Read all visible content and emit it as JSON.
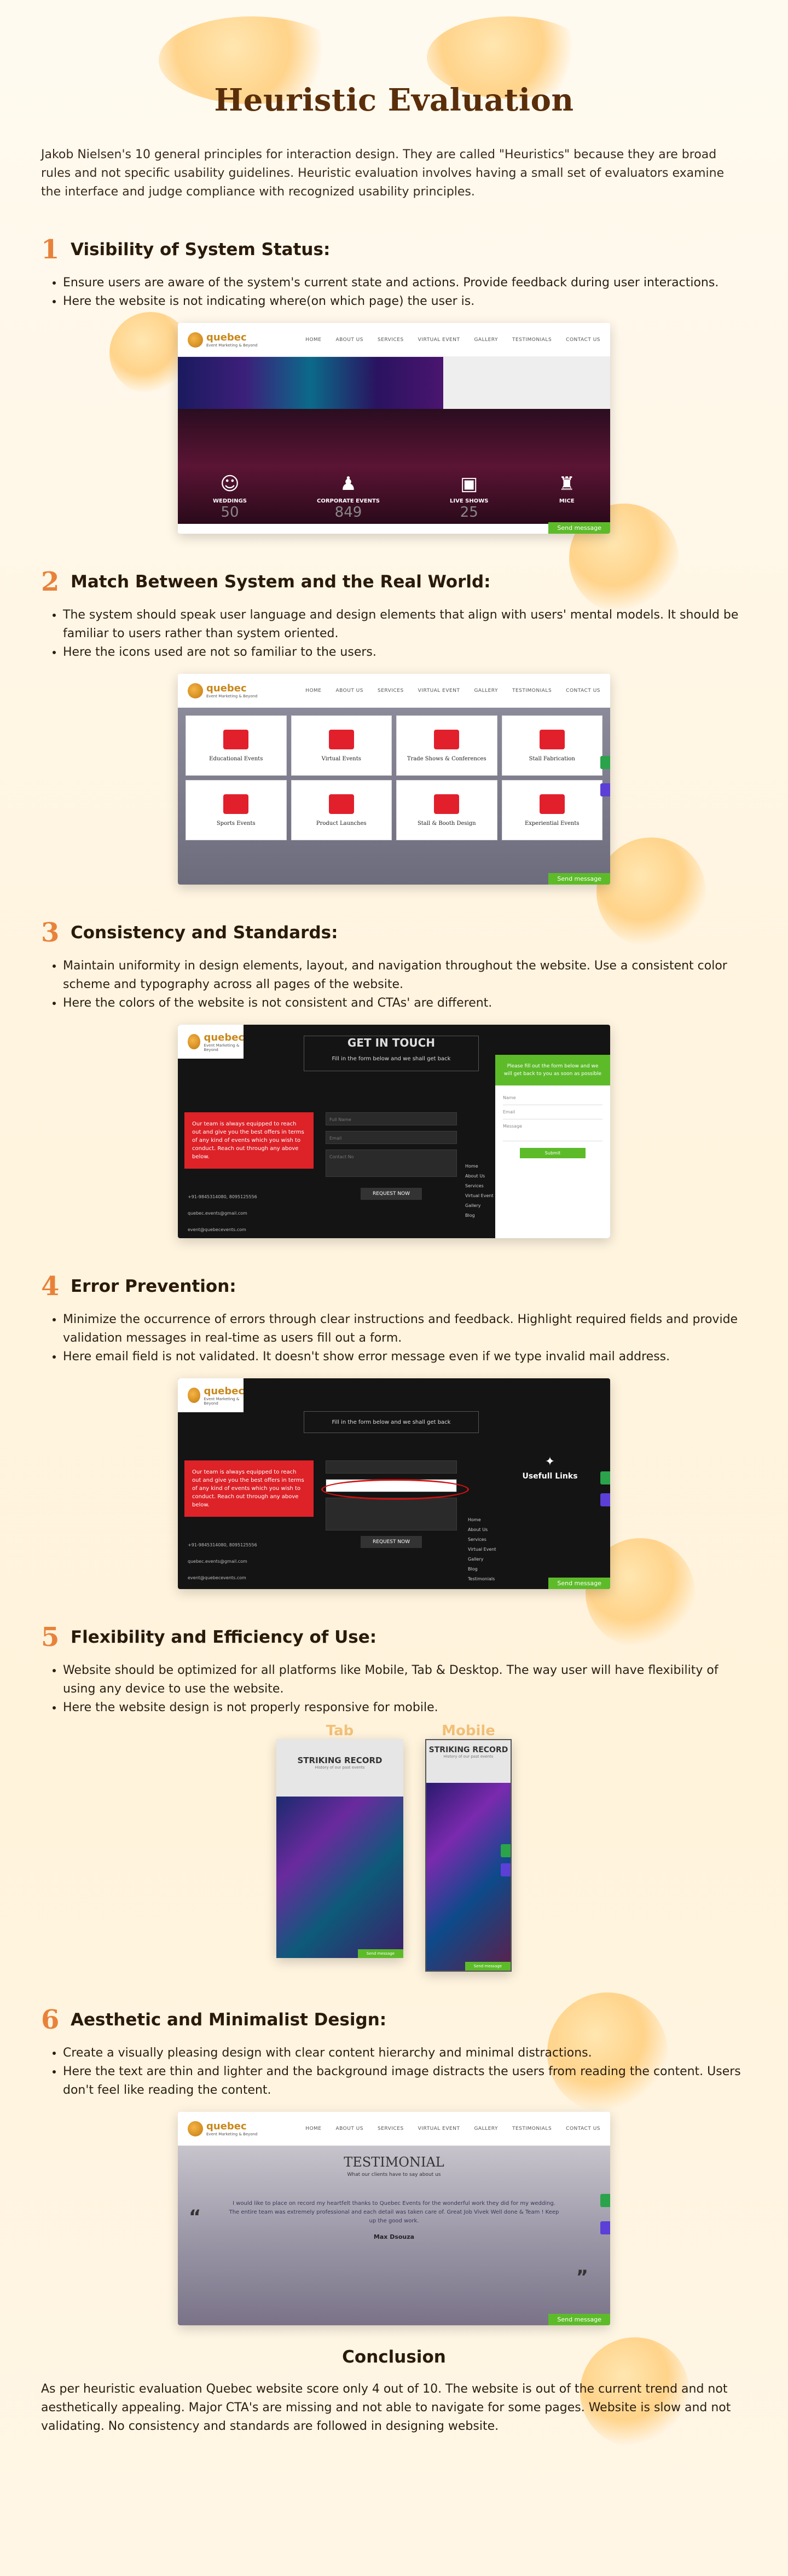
{
  "title": "Heuristic Evaluation",
  "intro": "Jakob Nielsen's 10 general principles for interaction design. They are called \"Heuristics\" because they are broad rules and not specific usability guidelines. Heuristic evaluation involves having a small set of evaluators examine the interface and judge compliance with recognized usability principles.",
  "sections": [
    {
      "number": "1",
      "heading": "Visibility of System Status:",
      "bullets": [
        "Ensure users are aware of the system's current state and actions. Provide feedback during user interactions.",
        "Here the website is not indicating where(on which page) the user is."
      ]
    },
    {
      "number": "2",
      "heading": "Match Between System and the Real World:",
      "bullets": [
        "The system should speak user language and design elements that align with users' mental models. It should be familiar to users rather than system oriented.",
        "Here the icons used are not so familiar to the users."
      ]
    },
    {
      "number": "3",
      "heading": "Consistency and Standards:",
      "bullets": [
        "Maintain uniformity in design elements, layout, and navigation throughout the website. Use a consistent color scheme and typography across all pages of the website.",
        "Here the colors of the website is not consistent and CTAs' are different."
      ]
    },
    {
      "number": "4",
      "heading": "Error Prevention:",
      "bullets": [
        "Minimize the occurrence of errors through clear instructions and feedback. Highlight required fields and provide validation messages in real-time as users fill out a form.",
        "Here email field is not validated. It doesn't show error message even if we type invalid mail address."
      ]
    },
    {
      "number": "5",
      "heading": "Flexibility and Efficiency of Use:",
      "bullets": [
        "Website should be optimized for all platforms like Mobile, Tab & Desktop.  The way user will have flexibility of using any device to use the website.",
        "Here the website design is not properly responsive for mobile."
      ]
    },
    {
      "number": "6",
      "heading": "Aesthetic and Minimalist Design:",
      "bullets": [
        "Create a visually pleasing design with clear content hierarchy and minimal distractions.",
        "Here the text are thin and lighter and the background image distracts the users from reading the content. Users don't feel like reading the content."
      ]
    }
  ],
  "site": {
    "logo": "quebec",
    "logo_tagline": "Event Marketing & Beyond",
    "nav": [
      "HOME",
      "ABOUT US",
      "SERVICES",
      "VIRTUAL EVENT",
      "GALLERY",
      "TESTIMONIALS",
      "CONTACT US"
    ],
    "send_message": "Send message"
  },
  "shot1": {
    "stats": [
      {
        "label": "WEDDINGS",
        "value": "50"
      },
      {
        "label": "CORPORATE EVENTS",
        "value": "849"
      },
      {
        "label": "LIVE SHOWS",
        "value": "25"
      },
      {
        "label": "MICE",
        "value": ""
      }
    ]
  },
  "shot2": {
    "tiles": [
      "Educational Events",
      "Virtual Events",
      "Trade Shows & Conferences",
      "Stall Fabrication",
      "Sports Events",
      "Product Launches",
      "Stall & Booth Design",
      "Experiential Events"
    ]
  },
  "shot3": {
    "heading": "GET IN TOUCH",
    "subheading": "Fill in the form below and we shall get back",
    "red_text": "Our team is always equipped to reach out and give you the best offers in terms of any kind of events which you wish to conduct. Reach out through any above below.",
    "fields": [
      "Full Name",
      "Email",
      "Contact No"
    ],
    "button": "REQUEST NOW",
    "contacts": [
      "+91-9845314080, 8095125556",
      "quebec.events@gmail.com",
      "event@quebecevents.com"
    ],
    "popup_text": "Please fill out the form below and we will get back to you as soon as possible",
    "popup_fields": [
      "Name",
      "Email",
      "Message"
    ],
    "popup_button": "Submit",
    "side_links": [
      "Home",
      "About Us",
      "Services",
      "Virtual Event",
      "Gallery",
      "Blog"
    ]
  },
  "shot4": {
    "subheading": "Fill in the form below and we shall get back",
    "useful_links": "Usefull Links",
    "links": [
      "Home",
      "About Us",
      "Services",
      "Virtual Event",
      "Gallery",
      "Blog",
      "Testimonials"
    ]
  },
  "shot5": {
    "tab_label": "Tab",
    "mobile_label": "Mobile",
    "heading": "STRIKING RECORD",
    "subheading": "History of our past events"
  },
  "shot6": {
    "heading": "TESTIMONIAL",
    "subheading": "What our clients have to say about us",
    "quote": "I would like to place on record my heartfelt thanks to Quebec Events for the wonderful work they did for my wedding. The entire team was extremely professional and each detail was taken care of. Great Job Vivek Well done & Team ! Keep up the good work.",
    "author": "Max Dsouza"
  },
  "conclusion_title": "Conclusion",
  "conclusion": "As per heuristic evaluation Quebec website score only 4 out of 10. The website is out of the current trend and not aesthetically appealing. Major CTA's are missing and not able to navigate for some pages. Website is slow and not validating. No consistency and standards are followed in designing website.",
  "colors": {
    "accent": "#e8823a",
    "heading": "#5a2e0a",
    "brand_red": "#dd2228",
    "brand_green": "#5dbb2a"
  }
}
